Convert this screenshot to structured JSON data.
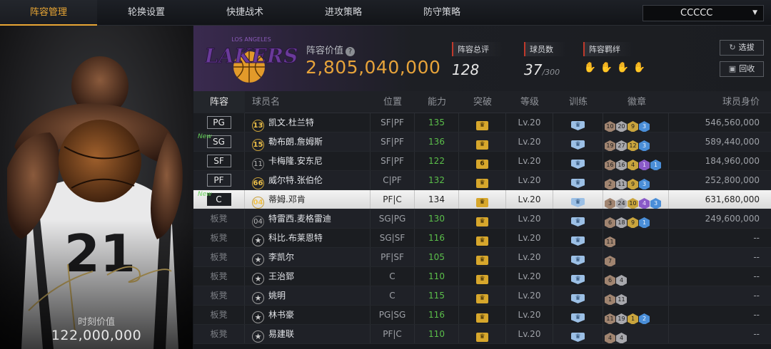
{
  "nav": {
    "tabs": [
      "阵容管理",
      "轮换设置",
      "快捷战术",
      "进攻策略",
      "防守策略"
    ],
    "team_select": "CCCCC"
  },
  "player_card": {
    "jersey_number": "21",
    "value_label": "时刻价值",
    "value": "122,000,000"
  },
  "team": {
    "logo_text": "LAKERS",
    "logo_subtext": "LOS ANGELES",
    "value_label": "阵容价值",
    "value": "2,805,040,000",
    "rating_label": "阵容总评",
    "rating": "128",
    "count_label": "球员数",
    "count": "37",
    "count_max": "/300",
    "bond_label": "阵容羁绊",
    "bond_icons": [
      "bond-icon-1",
      "bond-icon-2",
      "bond-icon-3",
      "bond-icon-4"
    ],
    "btn_choose": "选拔",
    "btn_recycle": "回收"
  },
  "table": {
    "headers": [
      "阵容",
      "球员名",
      "位置",
      "能力",
      "突破",
      "等级",
      "训练",
      "徽章",
      "球员身价"
    ],
    "rows": [
      {
        "slot": "PG",
        "new": "",
        "jersey": "13",
        "name": "凯文.杜兰特",
        "role": "SF|PF",
        "ability": "135",
        "breakthrough": "",
        "level": "Lv.20",
        "badges": [
          "10",
          "20",
          "9",
          "3"
        ],
        "value": "546,560,000"
      },
      {
        "slot": "SG",
        "new": "New",
        "jersey": "15",
        "name": "勒布朗.詹姆斯",
        "role": "SF|PF",
        "ability": "136",
        "breakthrough": "",
        "level": "Lv.20",
        "badges": [
          "19",
          "27",
          "12",
          "3"
        ],
        "value": "589,440,000"
      },
      {
        "slot": "SF",
        "new": "",
        "jersey": "11",
        "name": "卡梅隆.安东尼",
        "role": "SF|PF",
        "ability": "122",
        "breakthrough": "6",
        "level": "Lv.20",
        "badges": [
          "16",
          "16",
          "4",
          "1",
          "1"
        ],
        "value": "184,960,000"
      },
      {
        "slot": "PF",
        "new": "",
        "jersey": "66",
        "name": "威尔特.张伯伦",
        "role": "C|PF",
        "ability": "132",
        "breakthrough": "",
        "level": "Lv.20",
        "badges": [
          "2",
          "11",
          "9",
          "3"
        ],
        "value": "252,800,000"
      },
      {
        "slot": "C",
        "new": "New",
        "jersey": "04",
        "name": "蒂姆.邓肯",
        "role": "PF|C",
        "ability": "134",
        "breakthrough": "",
        "level": "Lv.20",
        "badges": [
          "3",
          "24",
          "10",
          "4",
          "3"
        ],
        "value": "631,680,000"
      },
      {
        "slot": "板凳",
        "new": "",
        "jersey": "04",
        "name": "特雷西.麦格雷迪",
        "role": "SG|PG",
        "ability": "130",
        "breakthrough": "",
        "level": "Lv.20",
        "badges": [
          "6",
          "18",
          "9",
          "1"
        ],
        "value": "249,600,000"
      },
      {
        "slot": "板凳",
        "new": "",
        "jersey": "★",
        "name": "科比.布莱恩特",
        "role": "SG|SF",
        "ability": "116",
        "breakthrough": "",
        "level": "Lv.20",
        "badges": [
          "11"
        ],
        "value": "--"
      },
      {
        "slot": "板凳",
        "new": "",
        "jersey": "★",
        "name": "李凯尔",
        "role": "PF|SF",
        "ability": "105",
        "breakthrough": "",
        "level": "Lv.20",
        "badges": [
          "7"
        ],
        "value": "--"
      },
      {
        "slot": "板凳",
        "new": "",
        "jersey": "★",
        "name": "王治郅",
        "role": "C",
        "ability": "110",
        "breakthrough": "",
        "level": "Lv.20",
        "badges": [
          "6",
          "4"
        ],
        "value": "--"
      },
      {
        "slot": "板凳",
        "new": "",
        "jersey": "★",
        "name": "姚明",
        "role": "C",
        "ability": "115",
        "breakthrough": "",
        "level": "Lv.20",
        "badges": [
          "1",
          "11"
        ],
        "value": "--"
      },
      {
        "slot": "板凳",
        "new": "",
        "jersey": "★",
        "name": "林书豪",
        "role": "PG|SG",
        "ability": "116",
        "breakthrough": "",
        "level": "Lv.20",
        "badges": [
          "11",
          "19",
          "1",
          "2"
        ],
        "value": "--"
      },
      {
        "slot": "板凳",
        "new": "",
        "jersey": "★",
        "name": "易建联",
        "role": "PF|C",
        "ability": "110",
        "breakthrough": "",
        "level": "Lv.20",
        "badges": [
          "4",
          "4"
        ],
        "value": "--"
      }
    ]
  },
  "colors": {
    "accent": "#e7a33a",
    "ability_green": "#5bbf4a",
    "new_tag": "#67d35a"
  }
}
